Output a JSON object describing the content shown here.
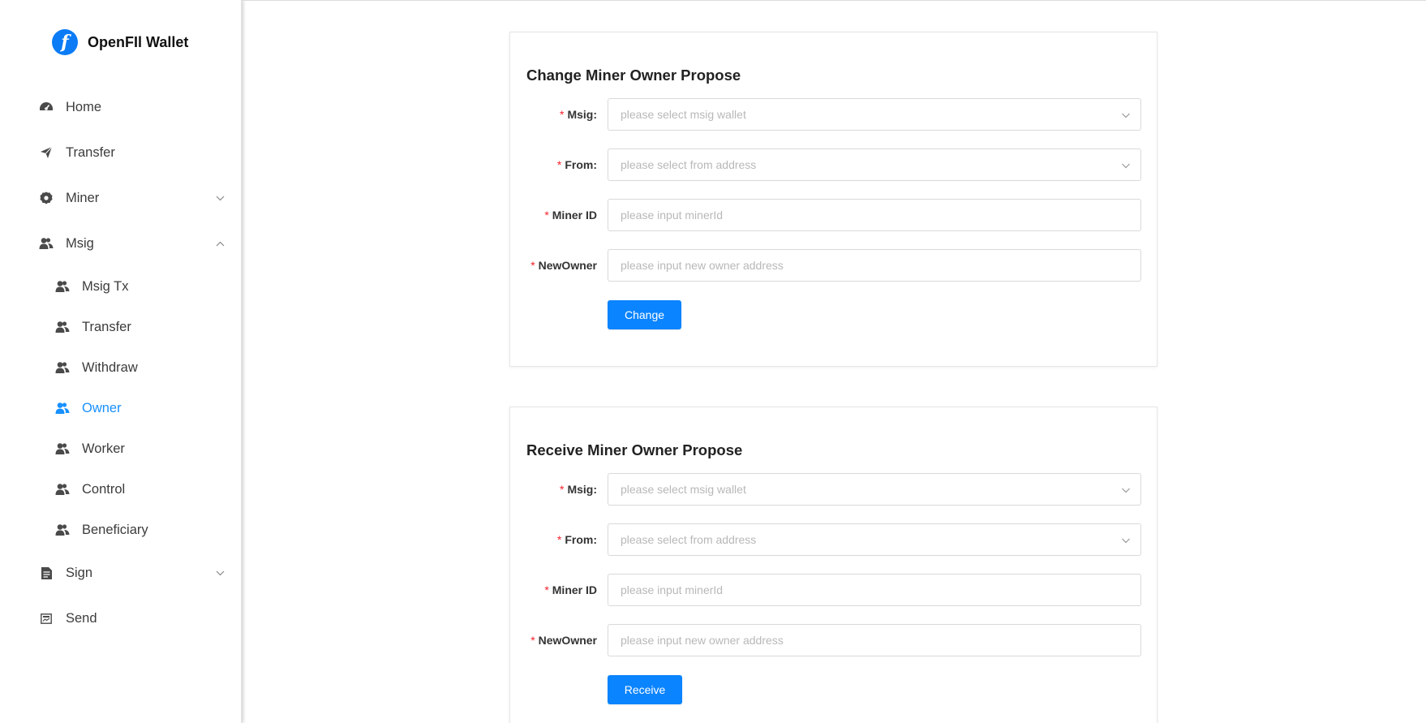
{
  "brand": {
    "name": "OpenFIl Wallet",
    "logo_glyph": "f"
  },
  "menu": {
    "home": "Home",
    "transfer": "Transfer",
    "miner": "Miner",
    "msig": "Msig",
    "msig_tx": "Msig Tx",
    "msig_transfer": "Transfer",
    "withdraw": "Withdraw",
    "owner": "Owner",
    "worker": "Worker",
    "control": "Control",
    "beneficiary": "Beneficiary",
    "sign": "Sign",
    "send": "Send"
  },
  "active_item": "owner",
  "accent_color": "#1890ff",
  "change_form": {
    "title": "Change Miner Owner Propose",
    "msig_label": "Msig:",
    "msig_placeholder": "please select msig wallet",
    "from_label": "From:",
    "from_placeholder": "please select from address",
    "miner_label": "Miner ID",
    "miner_placeholder": "please input minerId",
    "newowner_label": "NewOwner",
    "newowner_placeholder": "please input new owner address",
    "button": "Change"
  },
  "receive_form": {
    "title": "Receive Miner Owner Propose",
    "msig_label": "Msig:",
    "msig_placeholder": "please select msig wallet",
    "from_label": "From:",
    "from_placeholder": "please select from address",
    "miner_label": "Miner ID",
    "miner_placeholder": "please input minerId",
    "newowner_label": "NewOwner",
    "newowner_placeholder": "please input new owner address",
    "button": "Receive"
  }
}
